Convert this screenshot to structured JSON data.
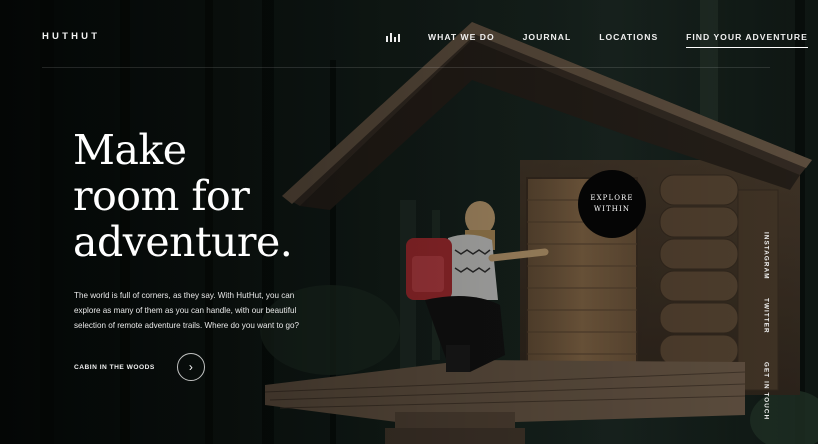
{
  "brand": {
    "logo": "HUTHUT"
  },
  "nav": {
    "icon": "bar-chart-icon",
    "links": [
      "WHAT WE DO",
      "JOURNAL",
      "LOCATIONS"
    ],
    "cta": "FIND YOUR ADVENTURE"
  },
  "hero": {
    "headline": [
      "Make",
      "room for",
      "adventure."
    ],
    "intro": "The world is full of corners, as they say. With HutHut, you can explore as many of them as you can handle, with our beautiful selection of remote adventure trails. Where do you want to go?",
    "cta_label": "CABIN IN THE WOODS",
    "cta_icon": "chevron-right-icon",
    "explore": [
      "EXPLORE",
      "WITHIN"
    ]
  },
  "social": [
    "INSTAGRAM",
    "TWITTER",
    "GET IN TOUCH"
  ],
  "colors": {
    "background": "#0f1714",
    "text": "#ffffff",
    "explore_badge": "#050505"
  }
}
